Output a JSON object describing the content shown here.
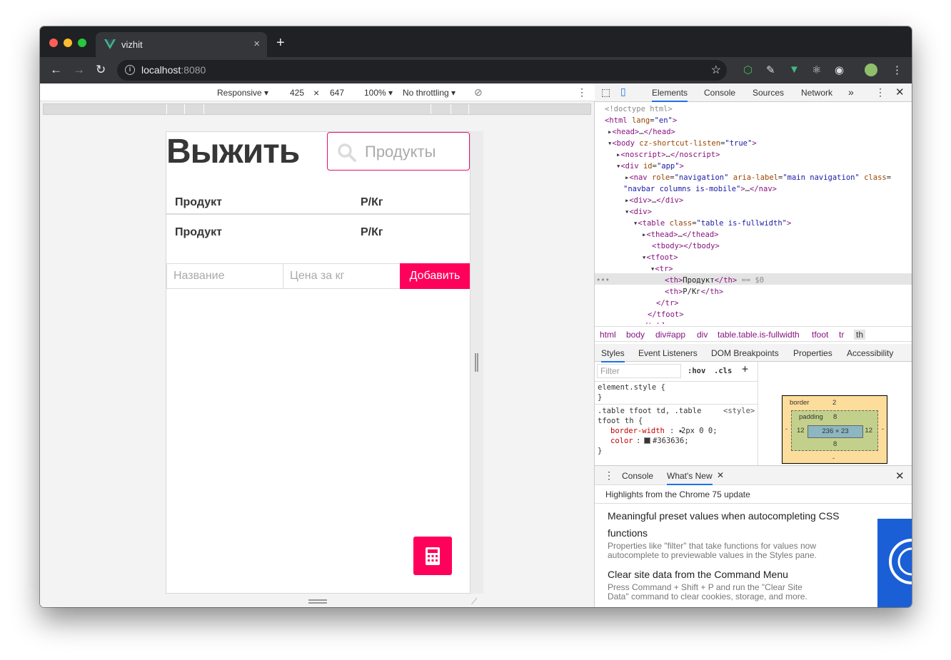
{
  "tab": {
    "title": "vizhit"
  },
  "address": {
    "host": "localhost",
    "port": ":8080"
  },
  "device_toolbar": {
    "mode": "Responsive ▾",
    "width": "425",
    "times": "×",
    "height": "647",
    "zoom": "100% ▾",
    "throttle": "No throttling ▾"
  },
  "app": {
    "title": "Выжить",
    "search_placeholder": "Продукты",
    "header_row": {
      "product": "Продукт",
      "price": "Р/Кг"
    },
    "footer_row": {
      "product": "Продукт",
      "price": "Р/Кг"
    },
    "name_placeholder": "Название",
    "price_placeholder": "Цена за кг",
    "add_label": "Добавить"
  },
  "devtools": {
    "tabs": [
      "Elements",
      "Console",
      "Sources",
      "Network"
    ],
    "more": "»",
    "breadcrumbs": [
      "html",
      "body",
      "div#app",
      "div",
      "table.table.is-fullwidth",
      "tfoot",
      "tr",
      "th"
    ],
    "style_tabs": [
      "Styles",
      "Event Listeners",
      "DOM Breakpoints",
      "Properties",
      "Accessibility"
    ],
    "filter_placeholder": "Filter",
    "hov": ":hov",
    "cls": ".cls",
    "plus": "+",
    "styles": {
      "element_style": "element.style {",
      "close": "}",
      "rule_selector": ".table tfoot td, .table",
      "rule_selector2": "tfoot th {",
      "rule_origin": "<style>",
      "prop1": "border-width",
      "val1": "2px 0 0;",
      "prop2": "color",
      "val2": "#363636;"
    },
    "box_model": {
      "border_label": "border",
      "border": "2",
      "padding_label": "padding",
      "padding": "8",
      "left": "12",
      "right": "12",
      "content": "236 × 23",
      "bottom": "8",
      "dash": "-"
    },
    "drawer_tabs": [
      "Console",
      "What's New"
    ],
    "highlights": "Highlights from the Chrome 75 update",
    "news": [
      {
        "title": "Meaningful preset values when autocompleting CSS",
        "title2": "functions",
        "body": "Properties like \"filter\" that take functions for values now",
        "body2": "autocomplete to previewable values in the Styles pane."
      },
      {
        "title": "Clear site data from the Command Menu",
        "body": "Press Command + Shift + P and run the \"Clear Site",
        "body2": "Data\" command to clear cookies, storage, and more."
      }
    ],
    "dom": {
      "doctype": "<!doctype html>",
      "eq": "== $0",
      "th1": "Продукт",
      "th2": "Р/Кг"
    }
  }
}
